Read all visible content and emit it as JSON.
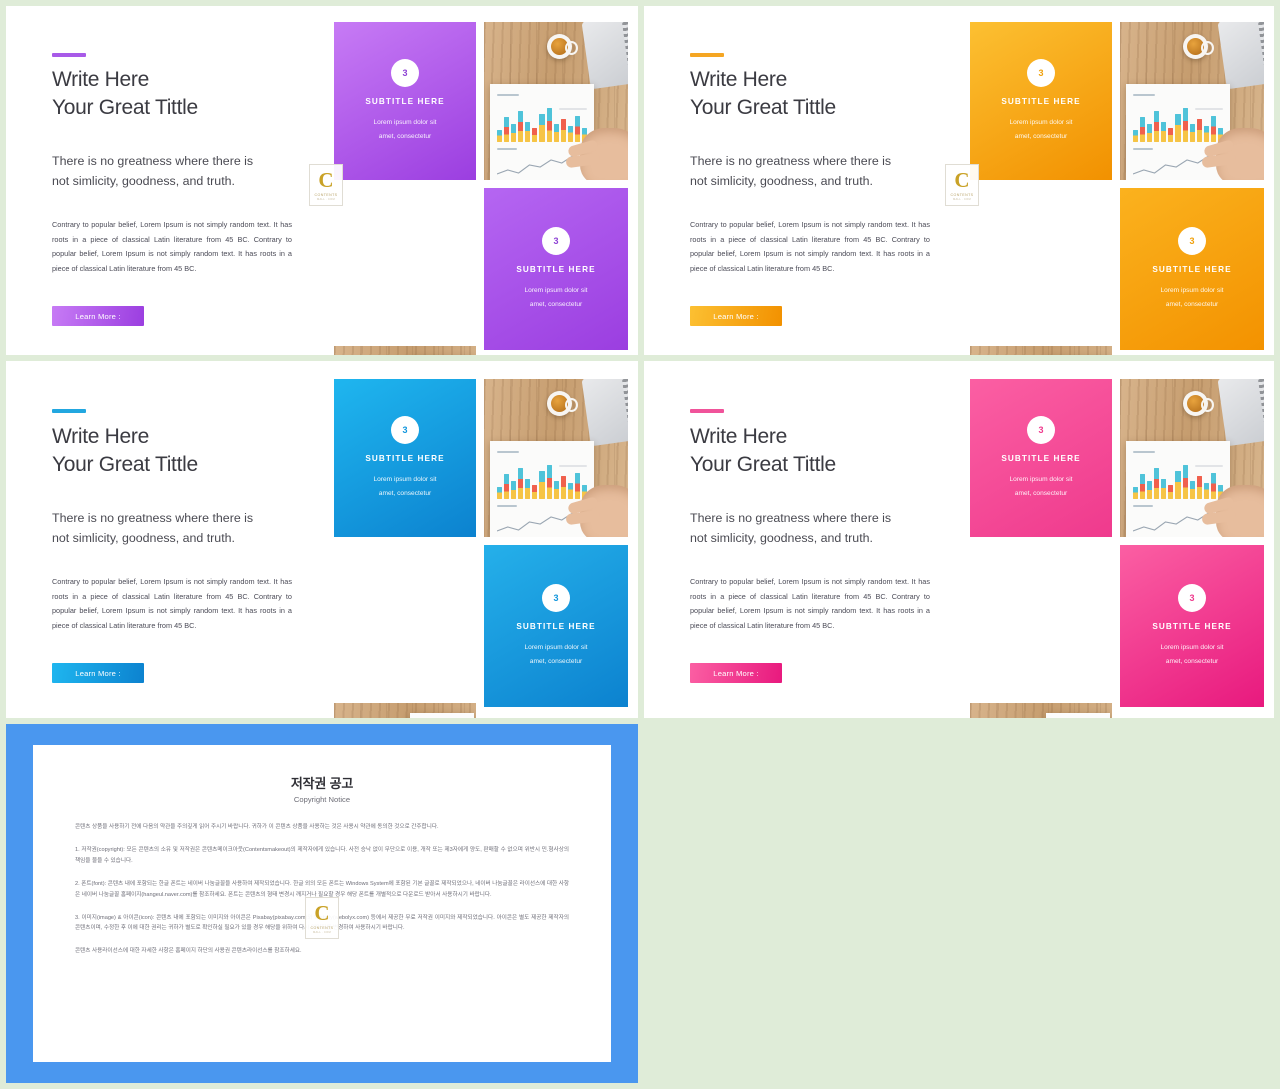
{
  "canvas": {
    "background": "#dfecd8"
  },
  "slides": [
    {
      "id": "slide-purple",
      "accent": "#a85ae8",
      "accent_gradient_from": "#c77bf5",
      "accent_gradient_to": "#9b3ee0",
      "button_gradient_from": "#c77bf5",
      "button_gradient_to": "#9b3ee0",
      "headline": "Write Here\nYour Great Tittle",
      "subline": "There is no greatness where there is\nnot simlicity, goodness, and truth.",
      "blurb": "Contrary to popular belief, Lorem Ipsum is not simply random text. It has roots in a piece of classical Latin literature from 45 BC. Contrary to popular belief, Lorem Ipsum is not simply random text. It has roots in a piece of classical Latin literature from 45 BC.",
      "button_label": "Learn More :",
      "tiles": [
        {
          "type": "color",
          "badge": "3",
          "subtitle": "SUBTITLE HERE",
          "desc": "Lorem ipsum dolor sit\namet, consectetur"
        },
        {
          "type": "photo",
          "scene": "desk-coffee-laptop-chart"
        },
        {
          "type": "photo",
          "scene": "hand-pointing-chart-document"
        },
        {
          "type": "color",
          "badge": "3",
          "subtitle": "SUBTITLE HERE",
          "desc": "Lorem ipsum dolor sit\namet, consectetur"
        }
      ]
    },
    {
      "id": "slide-orange",
      "accent": "#f5a623",
      "accent_gradient_from": "#fcc032",
      "accent_gradient_to": "#f29100",
      "button_gradient_from": "#fcc032",
      "button_gradient_to": "#f29100",
      "headline": "Write Here\nYour Great Tittle",
      "subline": "There is no greatness where there is\nnot simlicity, goodness, and truth.",
      "blurb": "Contrary to popular belief, Lorem Ipsum is not simply random text. It has roots in a piece of classical Latin literature from 45 BC. Contrary to popular belief, Lorem Ipsum is not simply random text. It has roots in a piece of classical Latin literature from 45 BC.",
      "button_label": "Learn More :",
      "tiles": [
        {
          "type": "color",
          "badge": "3",
          "subtitle": "SUBTITLE HERE",
          "desc": "Lorem ipsum dolor sit\namet, consectetur"
        },
        {
          "type": "photo",
          "scene": "desk-coffee-laptop-chart"
        },
        {
          "type": "photo",
          "scene": "hand-pointing-chart-document"
        },
        {
          "type": "color",
          "badge": "3",
          "subtitle": "SUBTITLE HERE",
          "desc": "Lorem ipsum dolor sit\namet, consectetur"
        }
      ]
    },
    {
      "id": "slide-blue",
      "accent": "#22a7e0",
      "accent_gradient_from": "#1fb6ef",
      "accent_gradient_to": "#0c82cf",
      "button_gradient_from": "#1fb6ef",
      "button_gradient_to": "#0c82cf",
      "headline": "Write Here\nYour Great Tittle",
      "subline": "There is no greatness where there is\nnot simlicity, goodness, and truth.",
      "blurb": "Contrary to popular belief, Lorem Ipsum is not simply random text. It has roots in a piece of classical Latin literature from 45 BC. Contrary to popular belief, Lorem Ipsum is not simply random text. It has roots in a piece of classical Latin literature from 45 BC.",
      "button_label": "Learn More :",
      "tiles": [
        {
          "type": "color",
          "badge": "3",
          "subtitle": "SUBTITLE HERE",
          "desc": "Lorem ipsum dolor sit\namet, consectetur"
        },
        {
          "type": "photo",
          "scene": "desk-coffee-laptop-chart"
        },
        {
          "type": "photo",
          "scene": "hand-pointing-chart-document"
        },
        {
          "type": "color",
          "badge": "3",
          "subtitle": "SUBTITLE HERE",
          "desc": "Lorem ipsum dolor sit\namet, consectetur"
        }
      ]
    },
    {
      "id": "slide-pink",
      "accent": "#f0539a",
      "accent_gradient_from": "#fb5fa3",
      "accent_gradient_to": "#e8197e",
      "button_gradient_from": "#fb5fa3",
      "button_gradient_to": "#e8197e",
      "headline": "Write Here\nYour Great Tittle",
      "subline": "There is no greatness where there is\nnot simlicity, goodness, and truth.",
      "blurb": "Contrary to popular belief, Lorem Ipsum is not simply random text. It has roots in a piece of classical Latin literature from 45 BC. Contrary to popular belief, Lorem Ipsum is not simply random text. It has roots in a piece of classical Latin literature from 45 BC.",
      "button_label": "Learn More :",
      "tiles": [
        {
          "type": "color",
          "badge": "3",
          "subtitle": "SUBTITLE HERE",
          "desc": "Lorem ipsum dolor sit\namet, consectetur"
        },
        {
          "type": "photo",
          "scene": "desk-coffee-laptop-chart"
        },
        {
          "type": "photo",
          "scene": "hand-pointing-chart-document"
        },
        {
          "type": "color",
          "badge": "3",
          "subtitle": "SUBTITLE HERE",
          "desc": "Lorem ipsum dolor sit\namet, consectetur"
        }
      ]
    }
  ],
  "watermark": {
    "letter": "C",
    "line1": "CONTENTS",
    "line2": "MALL . COM"
  },
  "copyright": {
    "frame_color": "#4a97ef",
    "title": "저작권 공고",
    "subtitle": "Copyright Notice",
    "paragraphs": [
      "콘텐츠 상품을 사용하기 전에 다음의 약관을 주의깊게 읽어 주시기 바랍니다. 귀하가 이 콘텐츠 상품을 사용하는 것은 사용시 약관에 동의한 것으로 간주합니다.",
      "1. 저작권(copyright): 모든 콘텐츠의 소유 및 저작권은 콘텐츠메이크아웃(Contentsmakeout)의 제작자에게 있습니다. 사전 승낙 없이 무단으로 이용, 개작 또는 제3자에게 양도, 판매할 수 없으며 위반시 민.형사상의 책임을 물을 수 있습니다.",
      "2. 폰트(font): 콘텐츠 내에 포함되는 한글 폰트는 네이버 나눔글꼴을 사용하여 제작되었습니다. 한글 외의 모든 폰트는 Windows System에 포함된 기본 글꼴로 제작되었으나, 네이버 나눔글꼴은 라이선스에 대한 사항은 네이버 나눔글꼴 홈페이지(hangeul.naver.com)를 참조하세요. 폰트는 콘텐츠의 형태 변경시 깨지거나 필요할 경우 해당 폰트를 개별적으로 다운로드 받아서 사용하시기 바랍니다.",
      "3. 이미지(image) & 아이콘(icon): 콘텐츠 내에 포함되는 이미지와 아이콘은 Pixabay(pixabay.com)와 Weboly(webolyx.com) 등에서 제공한 무료 저작권 이미지와 제작되었습니다. 아이콘은 별도 제공한 제작자의 콘텐츠이며, 수정한 후 이에 대한 권리는 귀하가 별도로 확인하실 필요가 있을 경우 해당을 위하여 다시 이미지를 변경하여 사용하시기 바랍니다.",
      "콘텐츠 사용라이선스에 대한 자세한 사항은 홈페이지 하단의 사용권 콘텐츠라이선스를 참조하세요."
    ]
  }
}
